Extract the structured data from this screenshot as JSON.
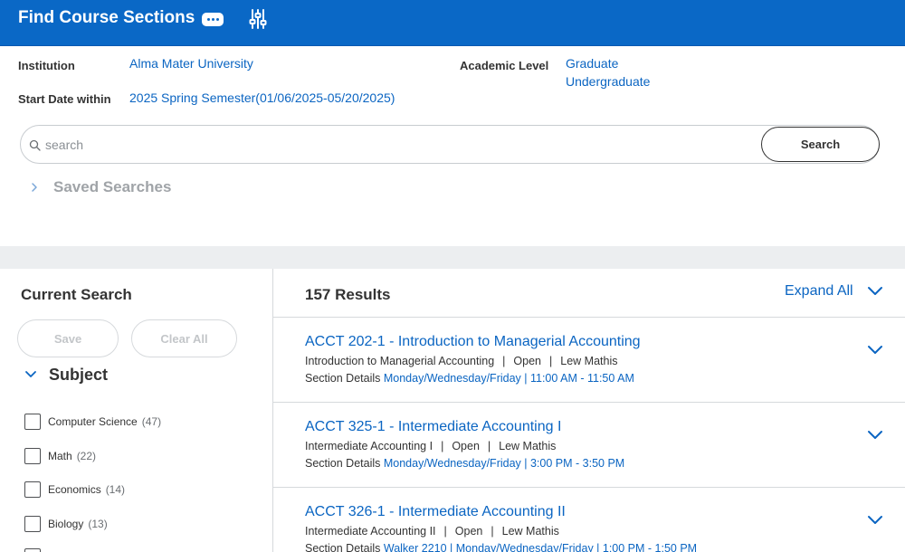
{
  "header": {
    "title": "Find Course Sections",
    "more_icon": "ellipsis-icon",
    "filter_icon": "sliders-icon"
  },
  "criteria": {
    "institution_label": "Institution",
    "institution_value": "Alma Mater University",
    "start_date_label": "Start Date within",
    "start_date_value": "2025 Spring Semester(01/06/2025-05/20/2025)",
    "academic_level_label": "Academic Level",
    "academic_levels": [
      "Graduate",
      "Undergraduate"
    ]
  },
  "search": {
    "placeholder": "search",
    "value": "",
    "button_label": "Search"
  },
  "saved_searches": {
    "label": "Saved Searches"
  },
  "sidebar": {
    "title": "Current Search",
    "save_label": "Save",
    "clear_all_label": "Clear All",
    "facet_title": "Subject",
    "facets": [
      {
        "label": "Computer Science",
        "count": "(47)"
      },
      {
        "label": "Math",
        "count": "(22)"
      },
      {
        "label": "Economics",
        "count": "(14)"
      },
      {
        "label": "Biology",
        "count": "(13)"
      }
    ]
  },
  "results": {
    "count_label": "157 Results",
    "expand_all_label": "Expand All",
    "items": [
      {
        "title": "ACCT 202-1 - Introduction to Managerial Accounting",
        "course": "Introduction to Managerial Accounting",
        "status": "Open",
        "instructor": "Lew Mathis",
        "details_label": "Section Details",
        "schedule": "Monday/Wednesday/Friday | 11:00 AM - 11:50 AM"
      },
      {
        "title": "ACCT 325-1 - Intermediate Accounting I",
        "course": "Intermediate Accounting I",
        "status": "Open",
        "instructor": "Lew Mathis",
        "details_label": "Section Details",
        "schedule": "Monday/Wednesday/Friday | 3:00 PM - 3:50 PM"
      },
      {
        "title": "ACCT 326-1 - Intermediate Accounting II",
        "course": "Intermediate Accounting II",
        "status": "Open",
        "instructor": "Lew Mathis",
        "details_label": "Section Details",
        "schedule": "Walker 2210 | Monday/Wednesday/Friday | 1:00 PM - 1:50 PM"
      }
    ]
  },
  "colors": {
    "brand": "#0a68c6",
    "link": "#0b65c2",
    "band": "#eceef0"
  }
}
